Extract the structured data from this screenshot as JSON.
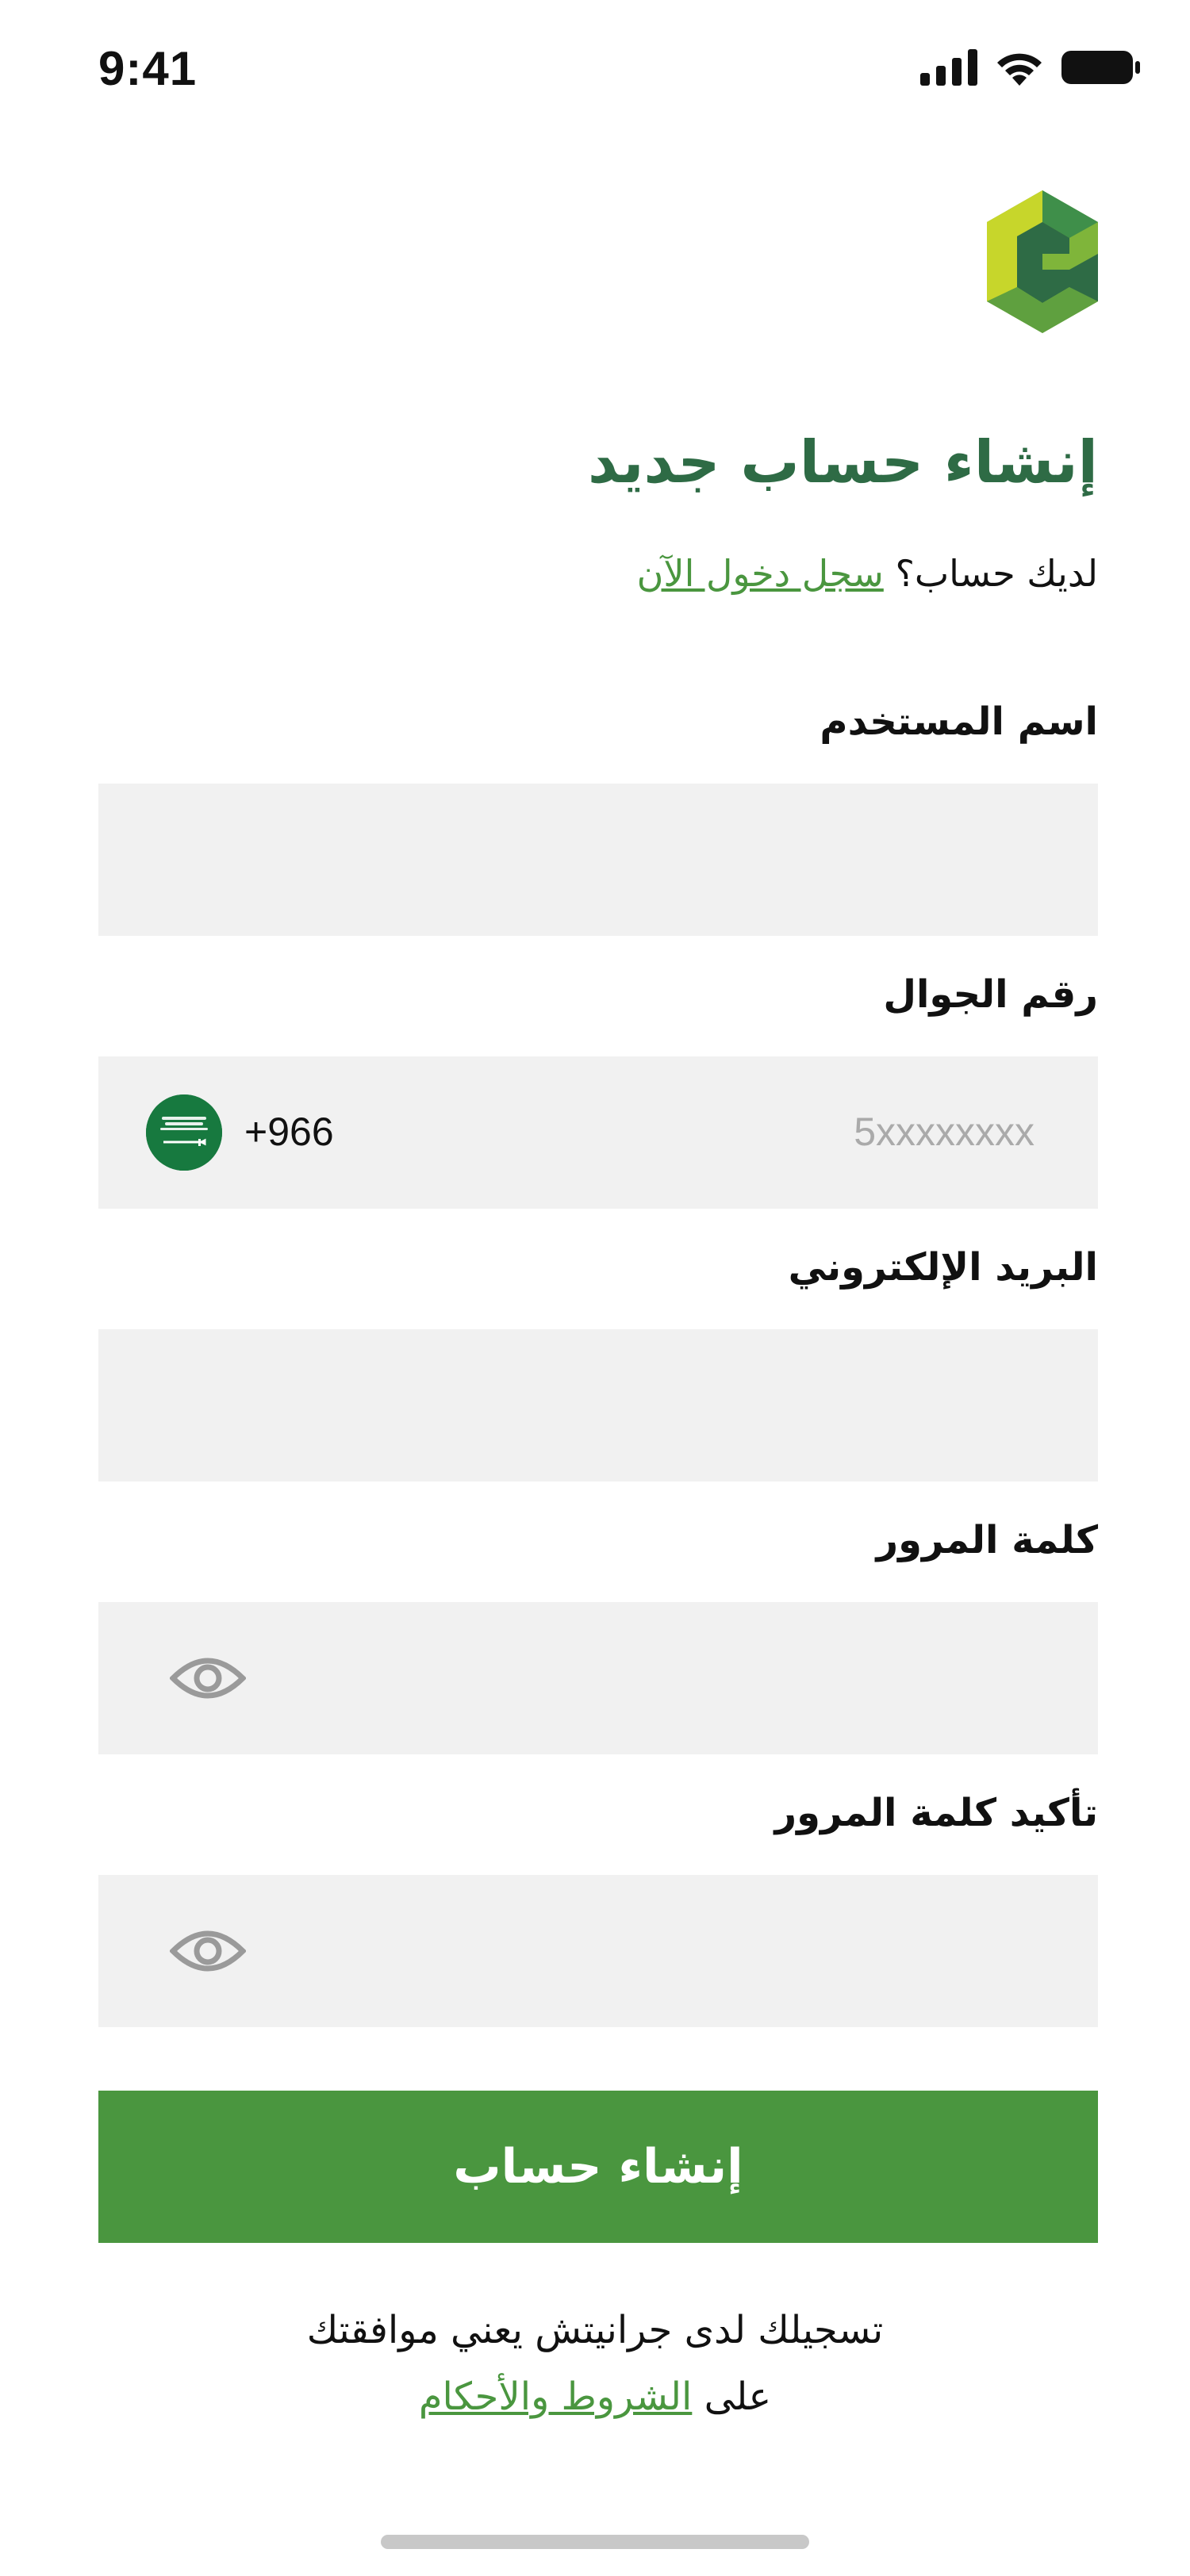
{
  "status_bar": {
    "time": "9:41"
  },
  "header": {
    "title": "إنشاء حساب جديد",
    "subtitle_prefix": "لديك حساب؟",
    "login_link": "سجل دخول الآن"
  },
  "form": {
    "username_label": "اسم المستخدم",
    "username_value": "",
    "phone_label": "رقم الجوال",
    "phone_code": "+966",
    "phone_placeholder": "5xxxxxxxx",
    "email_label": "البريد الإلكتروني",
    "email_value": "",
    "password_label": "كلمة المرور",
    "password_value": "",
    "confirm_password_label": "تأكيد كلمة المرور",
    "confirm_password_value": ""
  },
  "submit_label": "إنشاء حساب",
  "terms": {
    "line1": "تسجيلك لدى جرانيتش يعني موافقتك",
    "line2_prefix": "على",
    "terms_link": "الشروط والأحكام"
  },
  "colors": {
    "primary_green": "#4a963f",
    "title_green": "#2e6b45",
    "field_bg": "#f1f1f1",
    "flag_green": "#17793f"
  },
  "icons": {
    "signal": "cellular-signal-icon",
    "wifi": "wifi-icon",
    "battery": "battery-icon",
    "flag": "saudi-flag-icon",
    "eye": "eye-icon"
  }
}
